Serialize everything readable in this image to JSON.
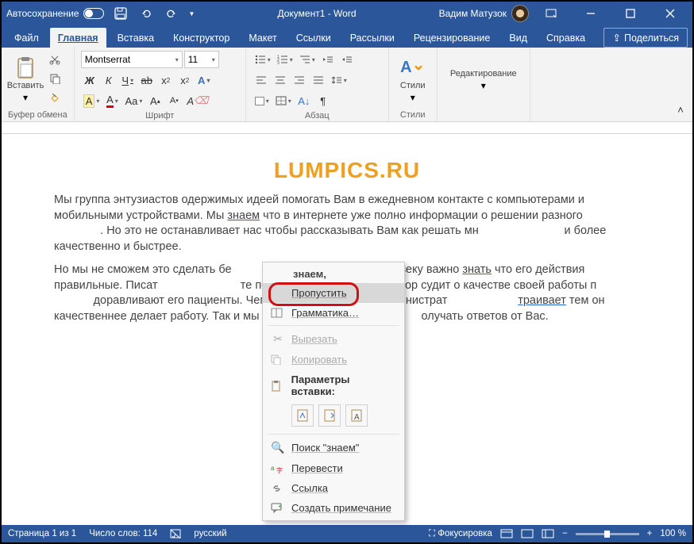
{
  "titlebar": {
    "autosave": "Автосохранение",
    "title": "Документ1 - Word",
    "user": "Вадим Матузок"
  },
  "tabs": {
    "file": "Файл",
    "home": "Главная",
    "insert": "Вставка",
    "design": "Конструктор",
    "layout": "Макет",
    "references": "Ссылки",
    "mailings": "Рассылки",
    "review": "Рецензирование",
    "view": "Вид",
    "help": "Справка",
    "share": "Поделиться"
  },
  "ribbon": {
    "clipboard": {
      "paste": "Вставить",
      "label": "Буфер обмена"
    },
    "font": {
      "name": "Montserrat",
      "size": "11",
      "label": "Шрифт"
    },
    "paragraph": {
      "label": "Абзац"
    },
    "styles": {
      "label": "Стили",
      "btn": "Стили"
    },
    "editing": {
      "label": "Редактирование"
    }
  },
  "document": {
    "watermark": "LUMPICS.RU",
    "p1a": "Мы группа энтузиастов одержимых идеей помогать Вам в ежедневном контакте с компьютерами и мобильными устройствами. Мы ",
    "p1err": "знаем",
    "p1b": " что в интернете уже полно информации о решении разного",
    "p1c": ". Но это не останавливает нас чтобы рассказывать Вам как решать мн",
    "p1d": "и более качественно и быстрее.",
    "p2a": "Но мы не сможем это сделать бе",
    "p2b": "и. Любому человеку важно ",
    "p2err": "знать",
    "p2c": " что его действия правильные. Писат",
    "p2d": "те по отзывам читателей. Доктор судит о качестве своей работы п",
    "p2e": "доравливают его пациенты. Чем меньше системный администрат",
    "p2err2": "траивает",
    "p2f": " тем он качественнее делает работу. Так и мы не можем улуч",
    "p2g": "олучать ответов от Вас."
  },
  "context_menu": {
    "word": "знаем,",
    "skip": "Пропустить",
    "grammar": "Грамматика…",
    "cut": "Вырезать",
    "copy": "Копировать",
    "paste_opts": "Параметры вставки:",
    "search": "Поиск \"знаем\"",
    "translate": "Перевести",
    "link": "Ссылка",
    "comment": "Создать примечание"
  },
  "statusbar": {
    "page": "Страница 1 из 1",
    "words": "Число слов: 114",
    "lang": "русский",
    "focus": "Фокусировка",
    "zoom": "100 %"
  }
}
